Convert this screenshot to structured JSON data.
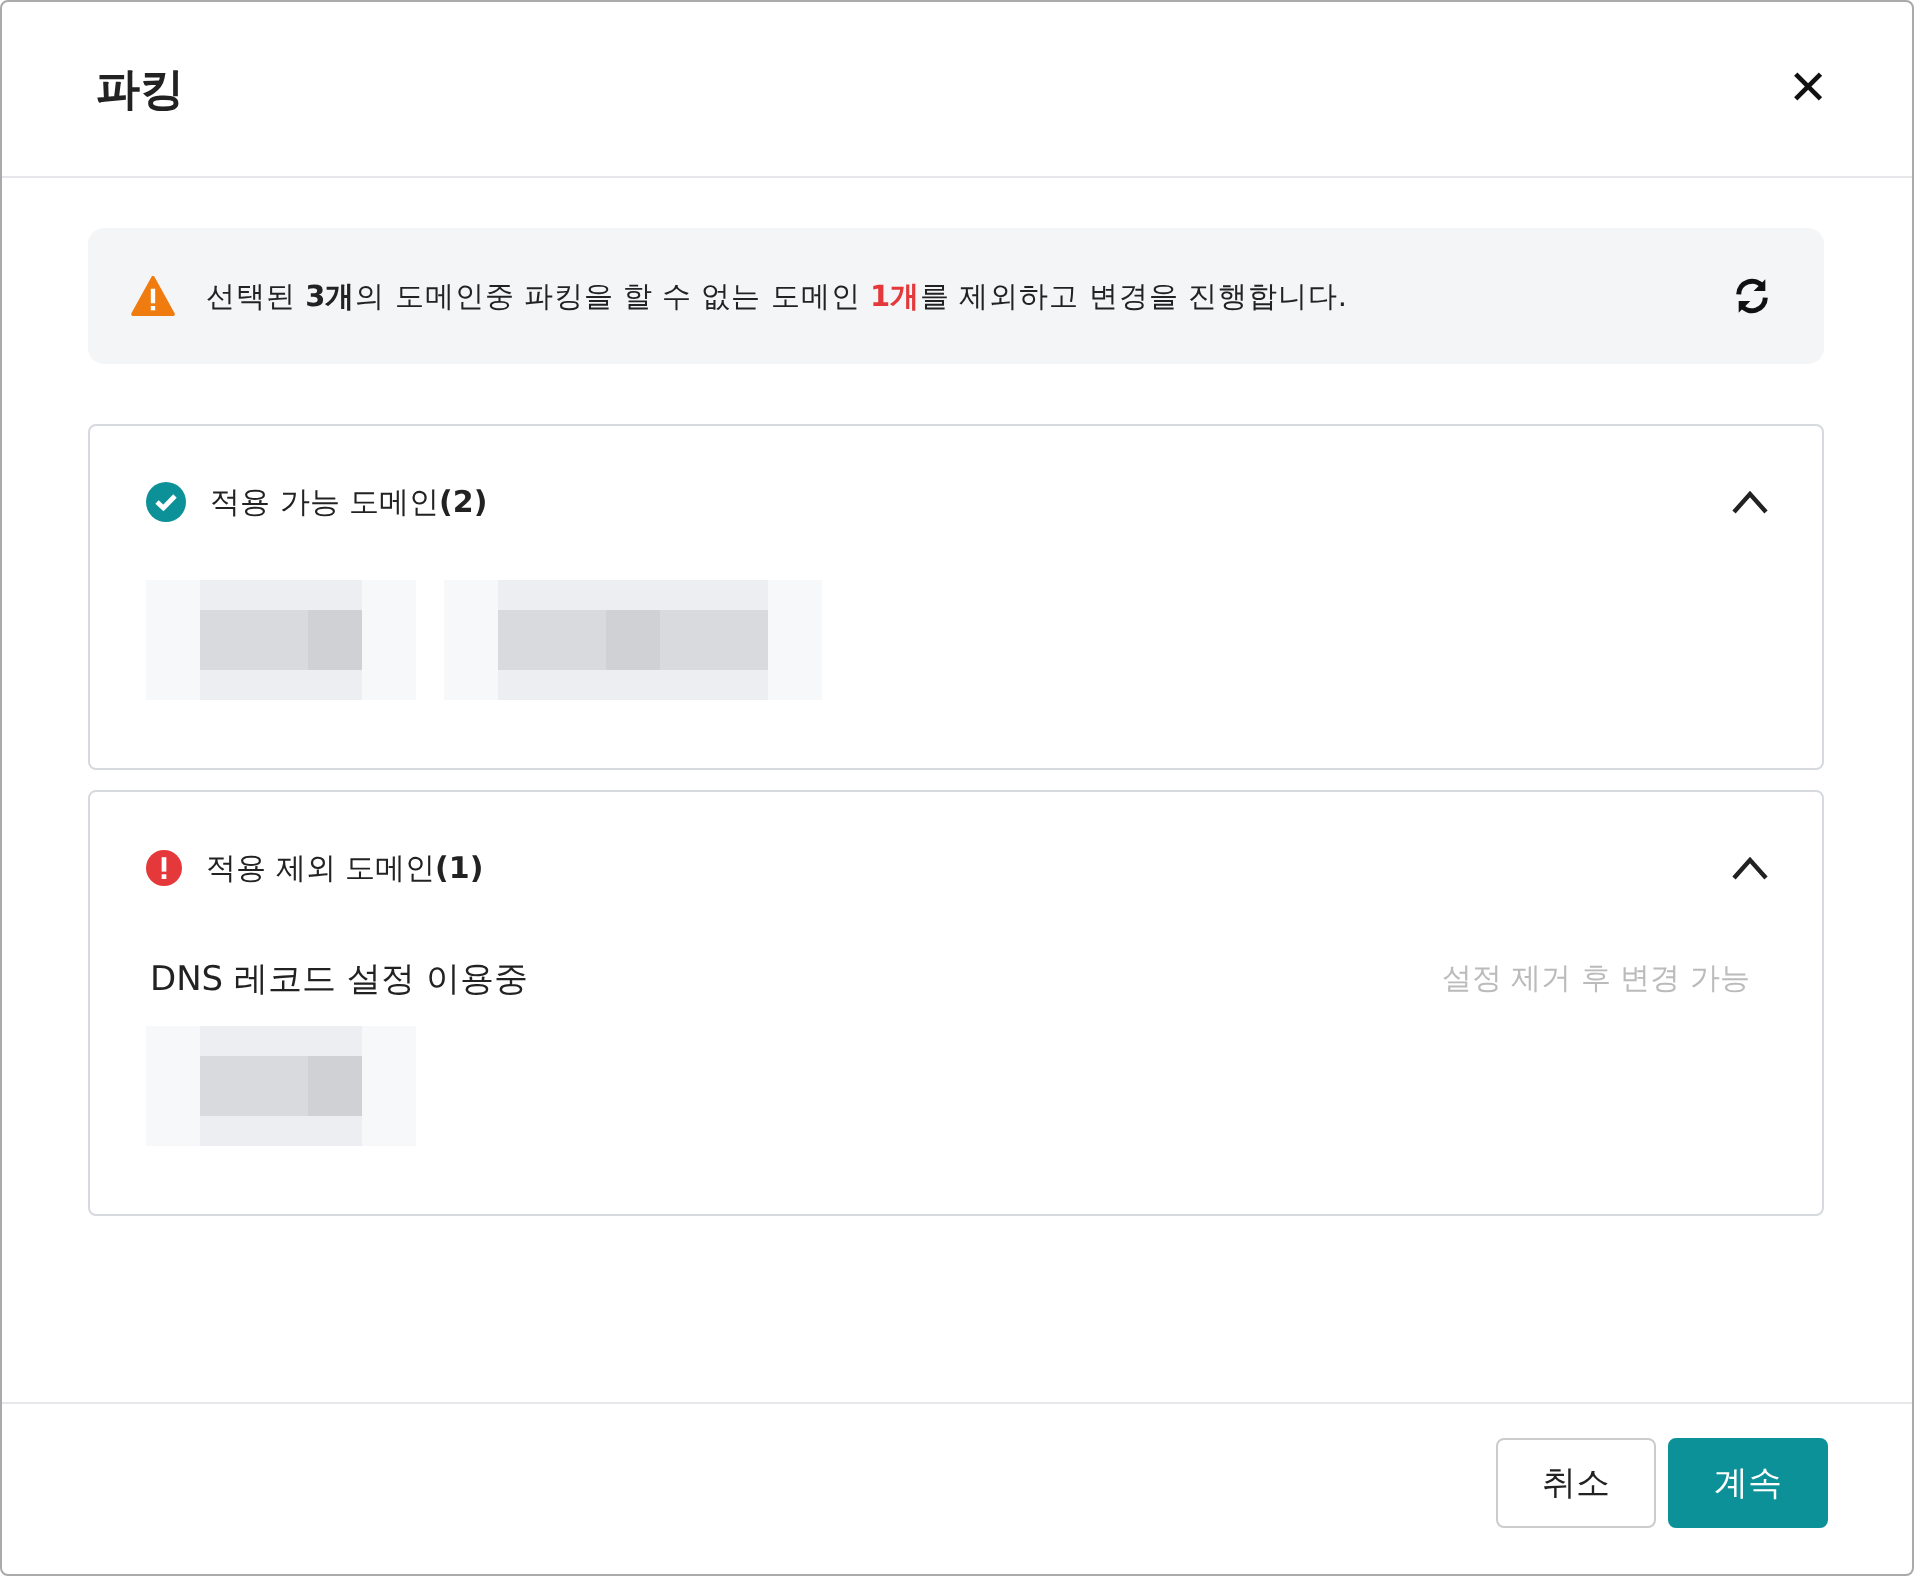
{
  "dialog": {
    "title": "파킹",
    "close": "✕"
  },
  "alert": {
    "before": "선택된 **3개**의 도메인중 파킹을 할 수 없는 도메인 ",
    "highlight": "1개",
    "after": "를 제외하고 변경을 진행합니다."
  },
  "sections": [
    {
      "kind": "ok",
      "title": "적용 가능 도메인",
      "count": "(2)",
      "expanded": true
    },
    {
      "kind": "error",
      "title": "적용 제외 도메인",
      "count": "(1)",
      "expanded": true,
      "groups": [
        {
          "reason": "DNS 레코드 설정 이용중",
          "hint": "설정 제거 후 변경 가능"
        }
      ]
    }
  ],
  "buttons": [
    {
      "label": "취소",
      "kind": "secondary"
    },
    {
      "label": "계속",
      "kind": "primary"
    }
  ]
}
